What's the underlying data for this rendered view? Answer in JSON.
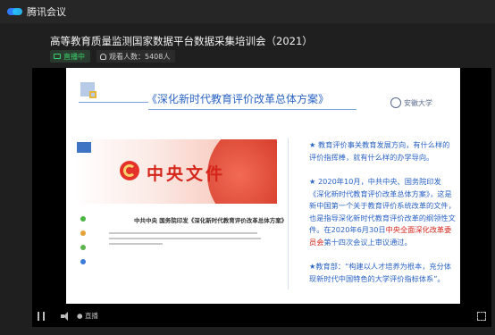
{
  "app": {
    "name": "腾讯会议"
  },
  "meeting": {
    "title": "高等教育质量监测国家数据平台数据采集培训会（2021）",
    "live_label": "直播中",
    "viewers_label": "观看人数：5408人"
  },
  "slide": {
    "title": "《深化新时代教育评价改革总体方案》",
    "university_logo": "安徽大学",
    "banner_text": "中央文件",
    "article_heading": "中共中央 国务院印发《深化新时代教育评价改革总体方案》",
    "bullets": [
      {
        "prefix": "★ ",
        "text": "教育评价事关教育发展方向，有什么样的评价指挥棒，就有什么样的办学导向。"
      },
      {
        "prefix": "★ ",
        "text": "2020年10月，中共中央、国务院印发《深化新时代教育评价改革总体方案》，这是新中国第一个关于教育评价系统改革的文件，也是指导深化新时代教育评价改革的纲领性文件。在2020年6月30日",
        "highlight": "中央全面深化改革委员会",
        "suffix": "第十四次会议上审议通过。"
      },
      {
        "prefix": "★",
        "text": "教育部：“构建以人才培养为根本，充分体现新时代中国特色的大学评价指标体系”。"
      }
    ]
  },
  "controls": {
    "live_label": "直播"
  },
  "colors": {
    "accent_blue": "#2a63c4",
    "accent_red": "#d6261c",
    "live_green": "#3ad06c"
  }
}
